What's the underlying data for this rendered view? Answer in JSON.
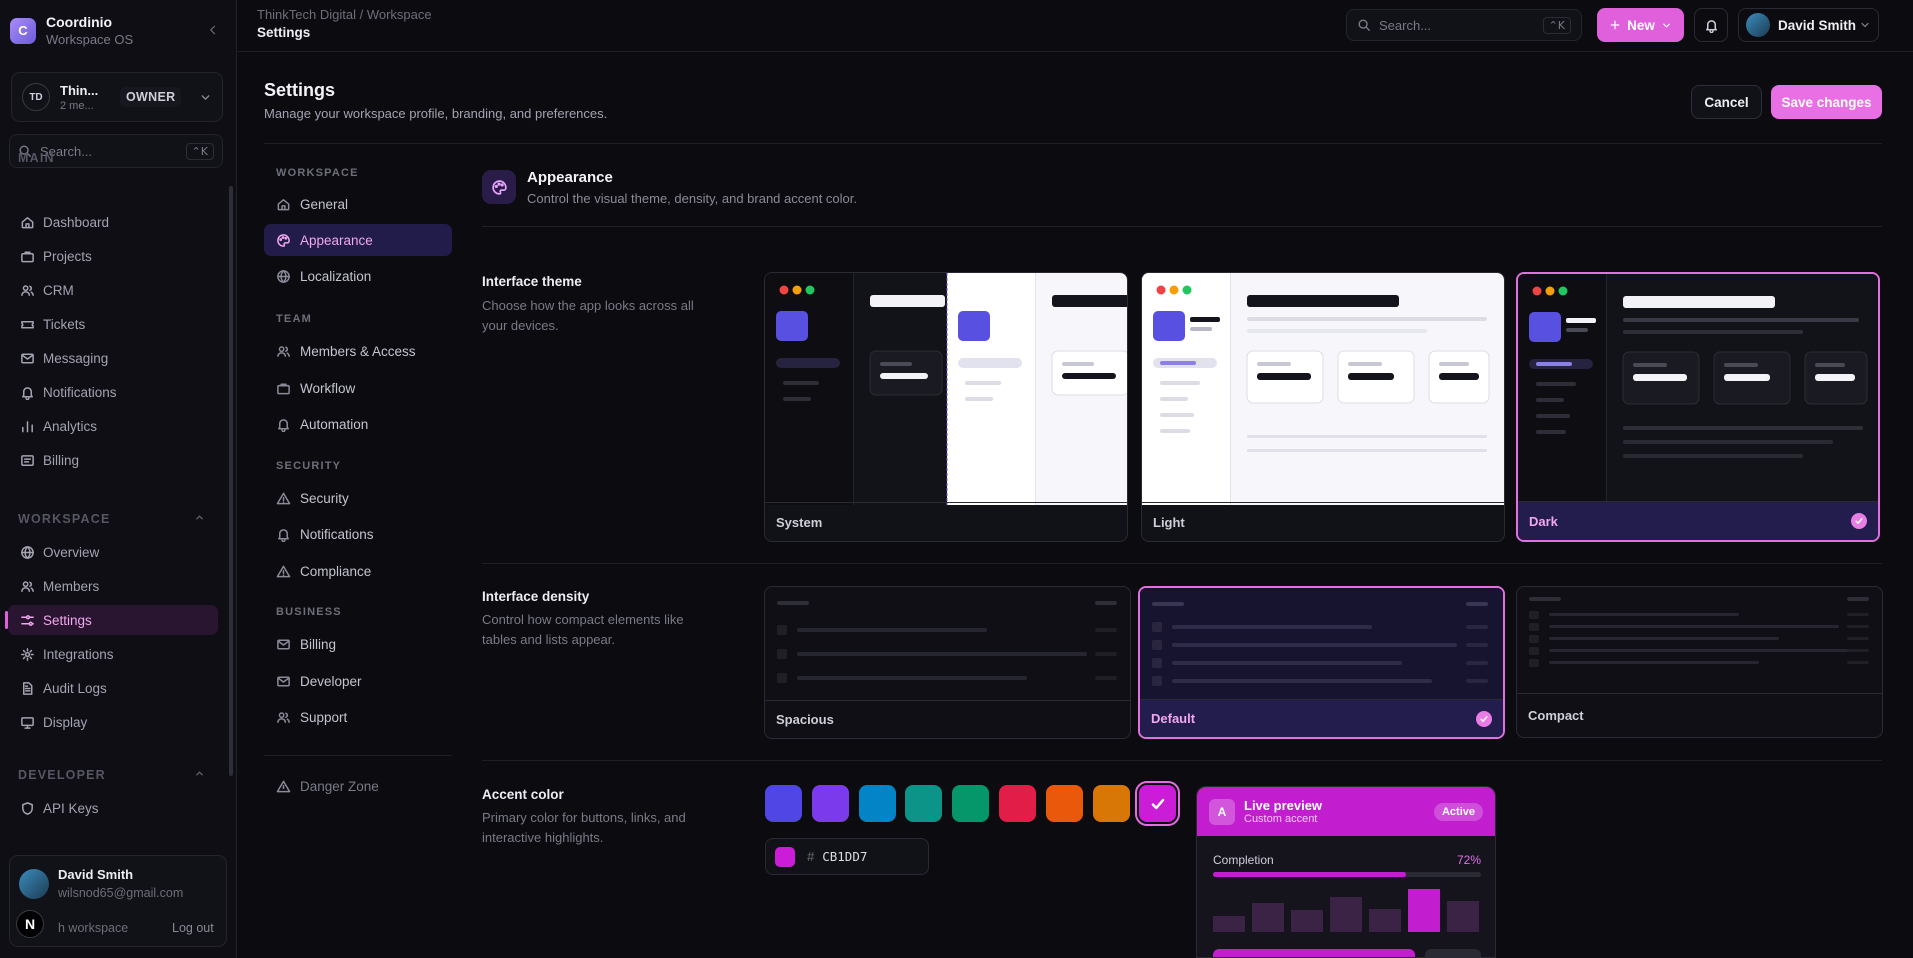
{
  "app": {
    "name": "Coordinio",
    "subtitle": "Workspace OS",
    "logo_letter": "C"
  },
  "org": {
    "initials": "TD",
    "name": "Thin...",
    "members": "2 me...",
    "role": "OWNER"
  },
  "sidebar": {
    "search_placeholder": "Search...",
    "search_shortcut": "⌃K",
    "sections": [
      {
        "title": "MAIN",
        "items": [
          {
            "label": "Dashboard",
            "icon": "home-icon"
          },
          {
            "label": "Projects",
            "icon": "briefcase-icon"
          },
          {
            "label": "CRM",
            "icon": "users-icon"
          },
          {
            "label": "Tickets",
            "icon": "ticket-icon"
          },
          {
            "label": "Messaging",
            "icon": "mail-icon"
          },
          {
            "label": "Notifications",
            "icon": "bell-icon"
          },
          {
            "label": "Analytics",
            "icon": "bar-chart-icon"
          },
          {
            "label": "Billing",
            "icon": "credit-card-icon"
          }
        ]
      },
      {
        "title": "WORKSPACE",
        "items": [
          {
            "label": "Overview",
            "icon": "globe-icon"
          },
          {
            "label": "Members",
            "icon": "users-icon"
          },
          {
            "label": "Settings",
            "icon": "sliders-icon",
            "active": true
          },
          {
            "label": "Integrations",
            "icon": "plug-icon"
          },
          {
            "label": "Audit Logs",
            "icon": "file-text-icon"
          },
          {
            "label": "Display",
            "icon": "monitor-icon"
          }
        ]
      },
      {
        "title": "DEVELOPER",
        "items": [
          {
            "label": "API Keys",
            "icon": "shield-icon"
          }
        ]
      }
    ]
  },
  "user": {
    "name": "David Smith",
    "email": "wilsnod65@gmail.com",
    "switch_label": "h workspace",
    "logout_label": "Log out",
    "badge": "N"
  },
  "topbar": {
    "breadcrumb": "ThinkTech Digital / Workspace",
    "title": "Settings",
    "search_placeholder": "Search...",
    "search_shortcut": "⌃K",
    "new_label": "New",
    "user_name": "David Smith"
  },
  "page": {
    "title": "Settings",
    "subtitle": "Manage your workspace profile, branding, and preferences.",
    "cancel_label": "Cancel",
    "save_label": "Save changes"
  },
  "settings_nav": [
    {
      "section": "WORKSPACE",
      "items": [
        {
          "label": "General",
          "icon": "home-icon"
        },
        {
          "label": "Appearance",
          "icon": "palette-icon",
          "active": true
        },
        {
          "label": "Localization",
          "icon": "globe-icon"
        }
      ]
    },
    {
      "section": "TEAM",
      "items": [
        {
          "label": "Members & Access",
          "icon": "users-icon"
        },
        {
          "label": "Workflow",
          "icon": "briefcase-icon"
        },
        {
          "label": "Automation",
          "icon": "bell-icon"
        }
      ]
    },
    {
      "section": "SECURITY",
      "items": [
        {
          "label": "Security",
          "icon": "warning-icon"
        },
        {
          "label": "Notifications",
          "icon": "bell-icon"
        },
        {
          "label": "Compliance",
          "icon": "warning-icon"
        }
      ]
    },
    {
      "section": "BUSINESS",
      "items": [
        {
          "label": "Billing",
          "icon": "mail-icon"
        },
        {
          "label": "Developer",
          "icon": "mail-icon"
        },
        {
          "label": "Support",
          "icon": "users-icon"
        }
      ]
    }
  ],
  "danger_zone_label": "Danger Zone",
  "appearance": {
    "title": "Appearance",
    "subtitle": "Control the visual theme, density, and brand accent color.",
    "theme": {
      "title": "Interface theme",
      "description": "Choose how the app looks across all your devices.",
      "options": [
        "System",
        "Light",
        "Dark"
      ],
      "selected": "Dark"
    },
    "density": {
      "title": "Interface density",
      "description": "Control how compact elements like tables and lists appear.",
      "options": [
        "Spacious",
        "Default",
        "Compact"
      ],
      "selected": "Default"
    },
    "accent": {
      "title": "Accent color",
      "description": "Primary color for buttons, links, and interactive highlights.",
      "swatches": [
        "#4f46e5",
        "#7c3aed",
        "#0284c7",
        "#0d9488",
        "#059669",
        "#e11d48",
        "#ea580c",
        "#d97706",
        "#cb1dd7"
      ],
      "selected": "#cb1dd7",
      "hex_symbol": "#",
      "hex_value": "CB1DD7"
    },
    "preview": {
      "letter": "A",
      "title": "Live preview",
      "subtitle": "Custom accent",
      "badge": "Active",
      "metric_label": "Completion",
      "metric_value": "72%",
      "progress": 0.72,
      "bars": [
        0.3,
        0.55,
        0.42,
        0.68,
        0.45,
        0.82,
        0.6
      ]
    }
  }
}
